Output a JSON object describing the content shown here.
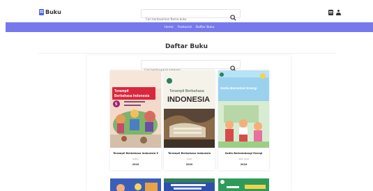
{
  "header": {
    "brand": "Buku",
    "search_placeholder": "Cari berdasarkan Nama buku"
  },
  "nav": {
    "items": [
      "Home",
      "Featured",
      "Daftar Buku"
    ]
  },
  "main": {
    "title": "Daftar Buku",
    "search_placeholder": "Cari berdasarkan kategori",
    "books": [
      {
        "title": "Terampil Berbahasa Indonesia 5",
        "author": "Sutini",
        "year": "2020",
        "cover_lines": [
          "Terampil",
          "Berbahasa Indonesia"
        ]
      },
      {
        "title": "Terampil Berbahasa Indonesia",
        "author": "Aceh",
        "year": "2020",
        "cover_lines": [
          "Terampil Berbahasa",
          "INDONESIA"
        ]
      },
      {
        "title": "Sedia Berkembangi Energi",
        "author": "Sitar Ariel",
        "year": "2018",
        "cover_lines": [
          "Sedia Bersemut Energi"
        ]
      }
    ]
  },
  "colors": {
    "accent": "#7579ec",
    "brand": "#5567e6"
  }
}
